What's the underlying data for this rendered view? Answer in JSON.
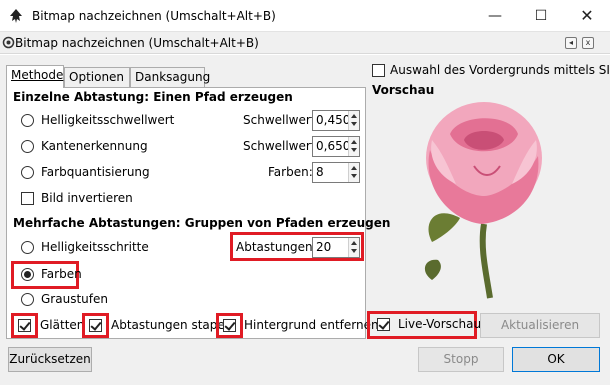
{
  "window": {
    "title": "Bitmap nachzeichnen (Umschalt+Alt+B)",
    "min": "—",
    "max": "☐",
    "close": "✕"
  },
  "dock": {
    "title": "Bitmap nachzeichnen (Umschalt+Alt+B)",
    "back": "◂",
    "close": "x"
  },
  "tabs": [
    "Methode",
    "Optionen",
    "Danksagung"
  ],
  "single_scan": {
    "title": "Einzelne Abtastung: Einen Pfad erzeugen",
    "options": [
      {
        "label": "Helligkeitsschwellwert",
        "param_label": "Schwellwert:",
        "value": "0,450",
        "selected": false
      },
      {
        "label": "Kantenerkennung",
        "param_label": "Schwellwert:",
        "value": "0,650",
        "selected": false
      },
      {
        "label": "Farbquantisierung",
        "param_label": "Farben:",
        "value": "8",
        "selected": false
      }
    ],
    "invert_label": "Bild invertieren",
    "invert_checked": false
  },
  "multi_scan": {
    "title": "Mehrfache Abtastungen: Gruppen von Pfaden erzeugen",
    "options": [
      {
        "label": "Helligkeitsschritte",
        "selected": false
      },
      {
        "label": "Farben",
        "selected": true
      },
      {
        "label": "Graustufen",
        "selected": false
      }
    ],
    "scans_label": "Abtastungen:",
    "scans_value": "20",
    "smooth_label": "Glätten",
    "smooth_checked": true,
    "stack_label": "Abtastungen stapeln",
    "stack_checked": true,
    "remove_bg_label": "Hintergrund entfernen",
    "remove_bg_checked": true
  },
  "siox": {
    "label": "Auswahl des Vordergrunds mittels SIOX",
    "checked": false
  },
  "preview": {
    "title": "Vorschau",
    "live_label": "Live-Vorschau",
    "live_checked": true,
    "update_label": "Aktualisieren"
  },
  "buttons": {
    "reset": "Zurücksetzen",
    "stop": "Stopp",
    "ok": "OK"
  },
  "colors": {
    "highlight": "#e01b24",
    "rose_petal": "#e8799a",
    "stem": "#5a6b2e"
  },
  "icons": {
    "app": "inkscape-icon",
    "dock": "bitmap-trace-icon"
  }
}
